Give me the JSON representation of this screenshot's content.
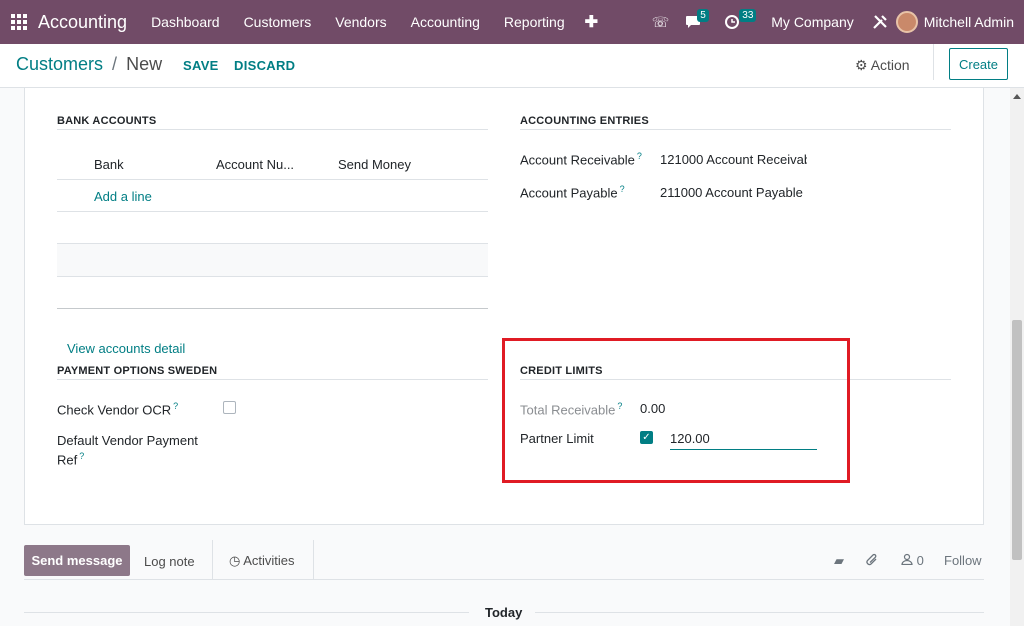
{
  "navbar": {
    "app_title": "Accounting",
    "menu": [
      "Dashboard",
      "Customers",
      "Vendors",
      "Accounting",
      "Reporting"
    ],
    "messages_count": "5",
    "activities_count": "33",
    "company": "My Company",
    "user": "Mitchell Admin"
  },
  "control": {
    "breadcrumb_parent": "Customers",
    "breadcrumb_sep": "/",
    "breadcrumb_current": "New",
    "save_label": "SAVE",
    "discard_label": "DISCARD",
    "action_label": "Action",
    "create_label": "Create"
  },
  "bank": {
    "title": "BANK ACCOUNTS",
    "col_bank": "Bank",
    "col_account": "Account Nu...",
    "col_send": "Send Money",
    "add_line": "Add a line",
    "view_detail": "View accounts detail"
  },
  "entries": {
    "title": "ACCOUNTING ENTRIES",
    "receivable_label": "Account Receivable",
    "receivable_value": "121000 Account Receivab",
    "payable_label": "Account Payable",
    "payable_value": "211000 Account Payable"
  },
  "payment": {
    "title": "PAYMENT OPTIONS SWEDEN",
    "ocr_label": "Check Vendor OCR",
    "ref_label_1": "Default Vendor Payment",
    "ref_label_2": "Ref"
  },
  "credit": {
    "title": "CREDIT LIMITS",
    "total_label": "Total Receivable",
    "total_value": "0.00",
    "partner_label": "Partner Limit",
    "partner_value": "120.00"
  },
  "chatter": {
    "send_message": "Send message",
    "log_note": "Log note",
    "activities": "Activities",
    "followers_count": "0",
    "follow": "Follow",
    "today": "Today"
  },
  "help_mark": "?"
}
